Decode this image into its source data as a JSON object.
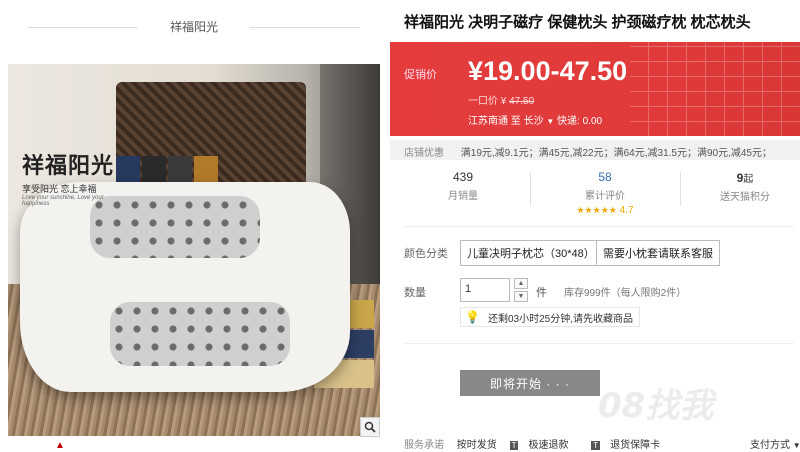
{
  "shop": {
    "name": "祥福阳光"
  },
  "product_image": {
    "logo_text": "祥福阳光",
    "logo_sub": "享受阳光 恋上幸福",
    "logo_en": "Love your sunshine, Love your happiness"
  },
  "product": {
    "title": "祥福阳光 决明子磁疗 保健枕头 护颈磁疗枕 枕芯枕头"
  },
  "promo": {
    "label": "促销价",
    "price": "¥19.00-47.50",
    "orig_label": "一口价",
    "orig_currency": "¥",
    "orig_price": "47.50",
    "ship_from": "江苏南通",
    "ship_to_word": "至",
    "ship_to": "长沙",
    "express": "快递: 0.00",
    "accent_color": "#e23c3c"
  },
  "coupons": {
    "label": "店铺优惠",
    "text": "满19元,减9.1元；满45元,减22元；满64元,减31.5元；满90元,减45元；"
  },
  "stats": {
    "monthly_sales": "439",
    "monthly_sales_label": "月销量",
    "reviews": "58",
    "reviews_label": "累计评价",
    "rating": "4.7",
    "points": "9",
    "points_unit": "起",
    "points_label": "送天猫积分"
  },
  "options": {
    "color_label": "颜色分类",
    "items": [
      "儿童决明子枕芯（30*48）",
      "需要小枕套请联系客服"
    ]
  },
  "quantity": {
    "label": "数量",
    "value": "1",
    "unit": "件",
    "stock": "库存999件（每人限购2件）",
    "tip": "还剩03小时25分钟,请先收藏商品"
  },
  "buy_button": {
    "label": "即将开始 · · ·"
  },
  "service": {
    "label": "服务承诺",
    "items": [
      "按时发货",
      "极速退款",
      "退货保障卡"
    ],
    "pay_label": "支付方式"
  },
  "watermark": "08找我"
}
